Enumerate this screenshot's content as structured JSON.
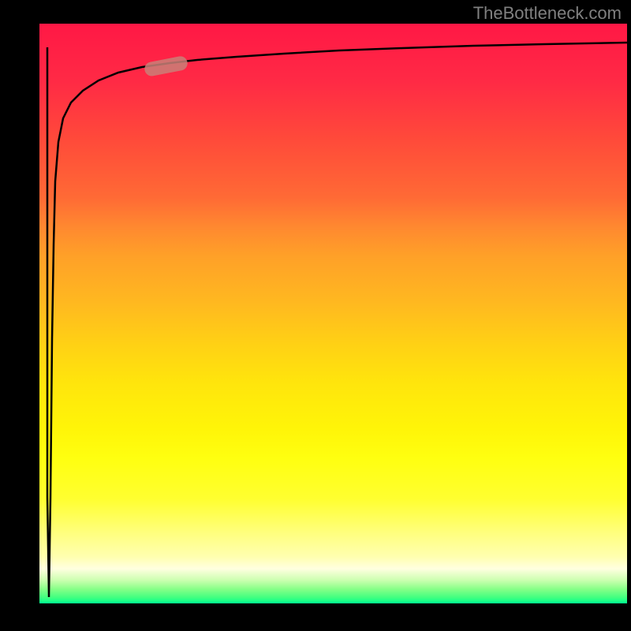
{
  "watermark": "TheBottleneck.com",
  "chart_data": {
    "type": "line",
    "title": "",
    "xlabel": "",
    "ylabel": "",
    "xlim": [
      0,
      100
    ],
    "ylim": [
      0,
      100
    ],
    "series": [
      {
        "name": "curve",
        "description": "Curve rising steeply from bottom and asymptotically approaching top",
        "x": [
          2,
          2,
          2,
          2.5,
          3,
          4,
          5,
          7,
          10,
          15,
          22,
          30,
          40,
          55,
          70,
          85,
          100
        ],
        "y": [
          0,
          30,
          60,
          75,
          82,
          86,
          88,
          90,
          91.5,
          92.5,
          93.3,
          94,
          94.7,
          95.3,
          95.8,
          96.2,
          96.5
        ]
      }
    ],
    "marker": {
      "description": "Salmon colored pill-shaped marker on curve",
      "x_range": [
        18,
        25
      ],
      "y_range": [
        92,
        93.5
      ],
      "color": "#c98078"
    }
  }
}
